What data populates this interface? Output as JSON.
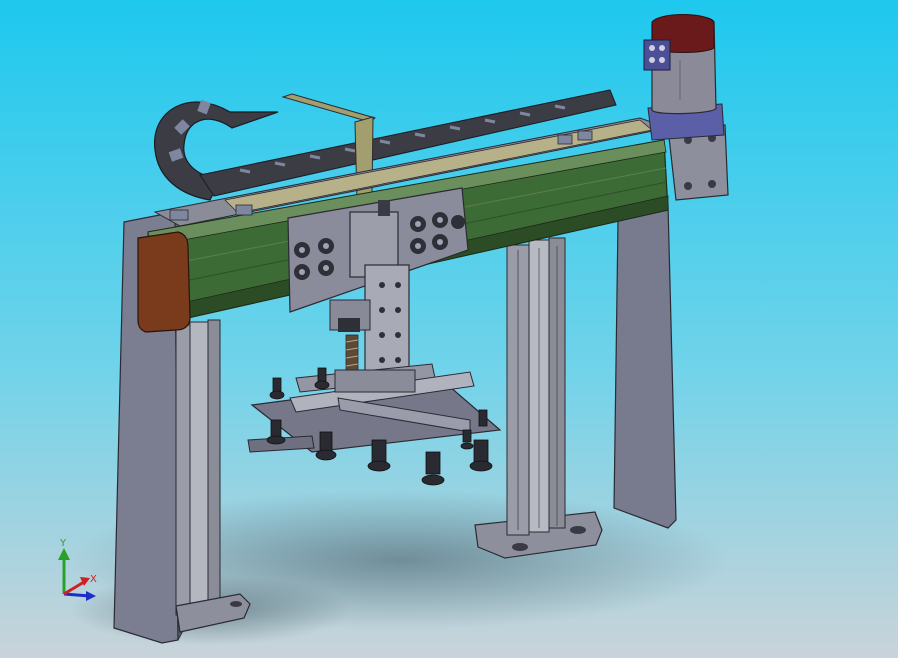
{
  "viewport": {
    "background_top": "#1ec8ee",
    "background_bottom": "#c9d3d9"
  },
  "colors": {
    "frame_gray": "#7b7d90",
    "beam_green": "#3d6b35",
    "end_cap_brown": "#7a3b1c",
    "motor_dark_red": "#6a1a1a",
    "motor_body": "#8a8a98",
    "cable_chain": "#3c3c44",
    "bracket_khaki": "#a39e6e",
    "coupler_blue": "#5a5fa8"
  },
  "triad": {
    "x_label": "X",
    "y_label": "Y",
    "icon": "axis-triad-icon"
  }
}
